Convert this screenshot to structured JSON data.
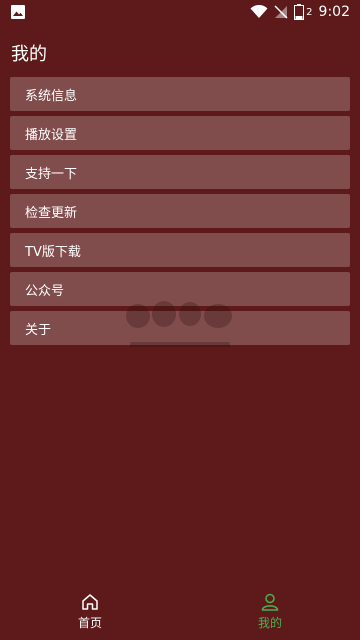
{
  "status_bar": {
    "time": "9:02",
    "battery_level": "2"
  },
  "page": {
    "title": "我的"
  },
  "menu": {
    "items": [
      {
        "label": "系统信息"
      },
      {
        "label": "播放设置"
      },
      {
        "label": "支持一下"
      },
      {
        "label": "检查更新"
      },
      {
        "label": "TV版下载"
      },
      {
        "label": "公众号"
      },
      {
        "label": "关于"
      }
    ]
  },
  "bottom_nav": {
    "home_label": "首页",
    "mine_label": "我的",
    "active": "mine"
  },
  "colors": {
    "background": "#5e1a1a",
    "active": "#4caf50"
  }
}
